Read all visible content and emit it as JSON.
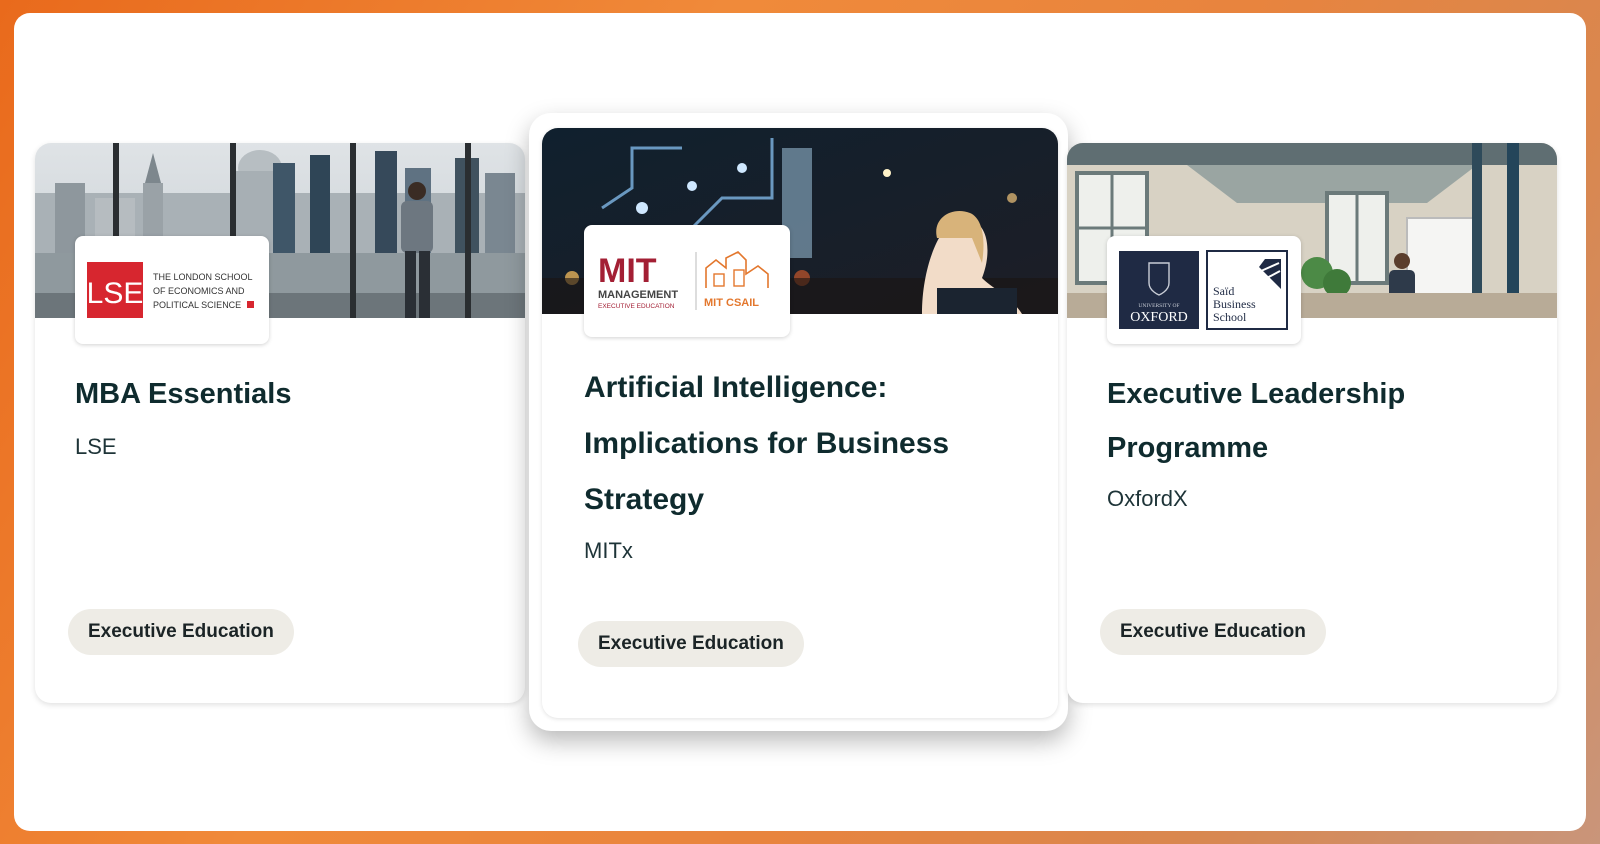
{
  "cards": [
    {
      "title": "MBA Essentials",
      "org": "LSE",
      "category": "Executive Education",
      "logo": {
        "mark": "LSE",
        "lines": [
          "THE LONDON SCHOOL",
          "OF ECONOMICS AND",
          "POLITICAL SCIENCE"
        ]
      }
    },
    {
      "title": "Artificial Intelligence: Implications for Business Strategy",
      "org": "MITx",
      "category": "Executive Education",
      "logo": {
        "mark": "MIT",
        "line1": "MANAGEMENT",
        "line2": "EXECUTIVE EDUCATION",
        "right": "MIT CSAIL"
      }
    },
    {
      "title": "Executive Leadership Programme",
      "org": "OxfordX",
      "category": "Executive Education",
      "logo": {
        "left_top": "UNIVERSITY OF",
        "left_main": "OXFORD",
        "right_lines": [
          "Saïd",
          "Business",
          "School"
        ]
      }
    }
  ],
  "colors": {
    "accent": "#e96a1c",
    "title": "#0f2b2e",
    "pill": "#eeece6",
    "lse_red": "#d7262f",
    "mit_red": "#a31f34",
    "oxford_navy": "#1f2a44",
    "csail_orange": "#e3772d"
  }
}
